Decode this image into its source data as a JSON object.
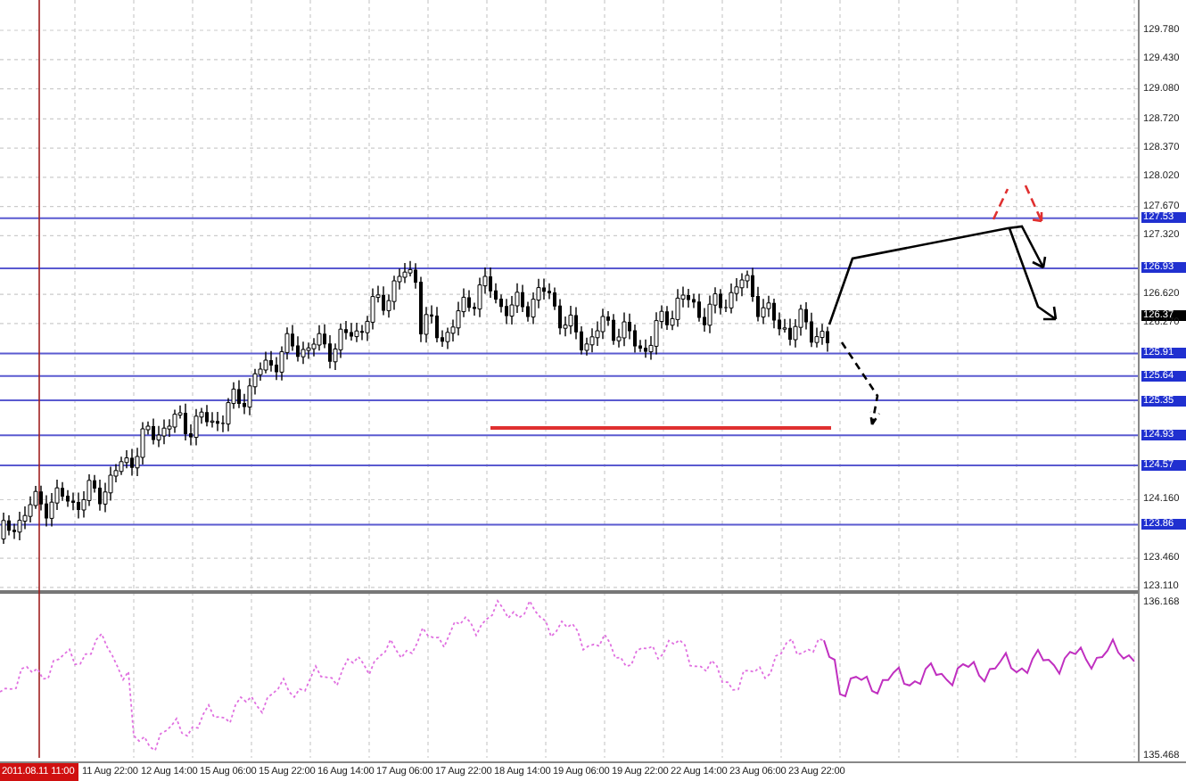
{
  "price_axis": {
    "labels": [
      {
        "kind": "tick",
        "label": "129.780"
      },
      {
        "kind": "tick",
        "label": "129.430"
      },
      {
        "kind": "tick",
        "label": "129.080"
      },
      {
        "kind": "tick",
        "label": "128.720"
      },
      {
        "kind": "tick",
        "label": "128.370"
      },
      {
        "kind": "tick",
        "label": "128.020"
      },
      {
        "kind": "tick",
        "label": "127.670"
      },
      {
        "kind": "level",
        "label": "127.53"
      },
      {
        "kind": "tick",
        "label": "127.320"
      },
      {
        "kind": "level",
        "label": "126.93"
      },
      {
        "kind": "tick",
        "label": "126.620"
      },
      {
        "kind": "price",
        "label": "126.37"
      },
      {
        "kind": "tick",
        "label": "126.270"
      },
      {
        "kind": "level",
        "label": "125.91"
      },
      {
        "kind": "level",
        "label": "125.64"
      },
      {
        "kind": "level",
        "label": "125.35"
      },
      {
        "kind": "level",
        "label": "124.93"
      },
      {
        "kind": "level",
        "label": "124.57"
      },
      {
        "kind": "tick",
        "label": "124.160"
      },
      {
        "kind": "level",
        "label": "123.86"
      },
      {
        "kind": "tick",
        "label": "123.460"
      },
      {
        "kind": "tick",
        "label": "123.110"
      }
    ]
  },
  "indicator_axis": {
    "labels": [
      "136.168",
      "135.468"
    ]
  },
  "time_axis": {
    "cursor_label": "2011.08.11 11:00",
    "labels": [
      "11 Aug 22:00",
      "12 Aug 14:00",
      "15 Aug 06:00",
      "15 Aug 22:00",
      "16 Aug 14:00",
      "17 Aug 06:00",
      "17 Aug 22:00",
      "18 Aug 14:00",
      "19 Aug 06:00",
      "19 Aug 22:00",
      "22 Aug 14:00",
      "23 Aug 06:00",
      "23 Aug 22:00"
    ]
  }
}
